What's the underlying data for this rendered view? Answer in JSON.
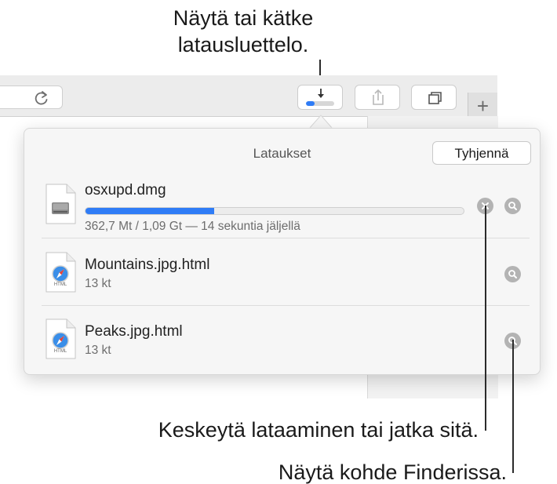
{
  "callouts": {
    "toggle_list_line1": "Näytä tai kätke",
    "toggle_list_line2": "latausluettelo.",
    "pause_resume": "Keskeytä lataaminen tai jatka sitä.",
    "show_in_finder": "Näytä kohde Finderissa."
  },
  "popover": {
    "title": "Lataukset",
    "clear_label": "Tyhjennä"
  },
  "toolbar": {
    "new_tab_label": "+",
    "downloads_progress": 0.3
  },
  "downloads": [
    {
      "name": "osxupd.dmg",
      "meta": "362,7 Mt / 1,09 Gt — 14 sekuntia jäljellä",
      "progress": 0.34,
      "icon": "disk-image-icon"
    },
    {
      "name": "Mountains.jpg.html",
      "meta": "13 kt",
      "icon": "html-file-icon",
      "icon_tag": "HTML"
    },
    {
      "name": "Peaks.jpg.html",
      "meta": "13 kt",
      "icon": "html-file-icon",
      "icon_tag": "HTML"
    }
  ],
  "colors": {
    "accent": "#2f7cf6",
    "toolbar": "#ececec",
    "popover": "#f6f6f6"
  }
}
